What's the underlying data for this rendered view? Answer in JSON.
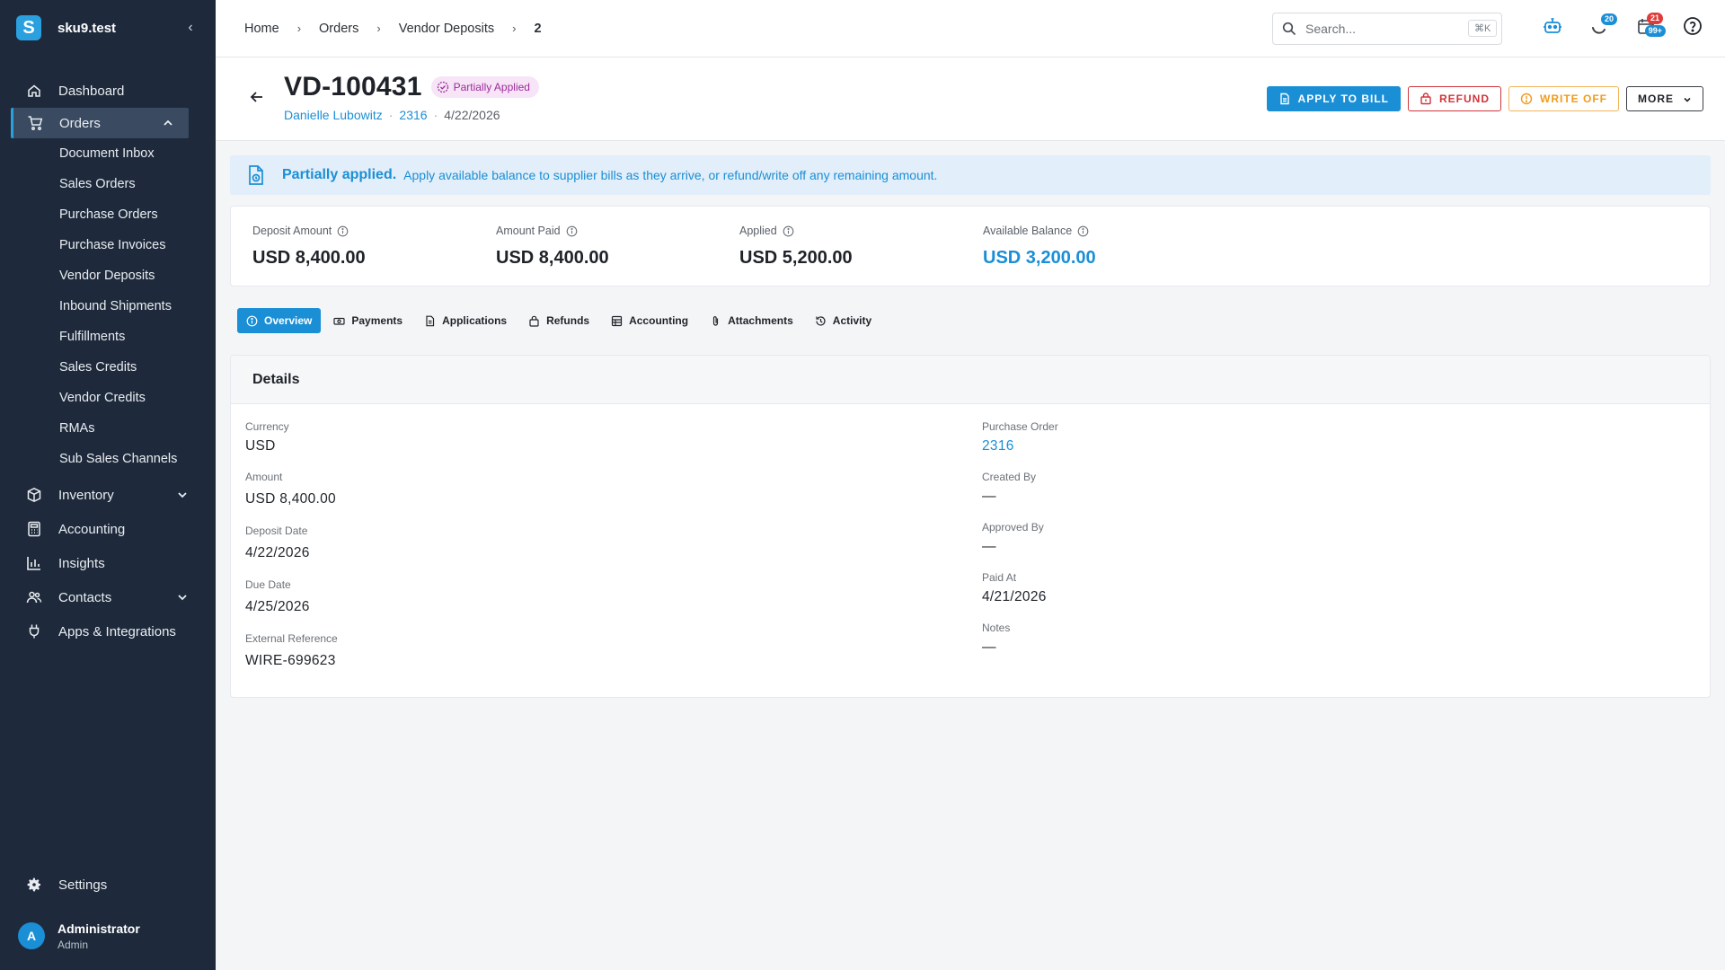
{
  "brand": {
    "name": "sku9.test",
    "logo_letter": "S",
    "collapse_icon": "chevron-left-icon"
  },
  "nav": {
    "dashboard": "Dashboard",
    "orders": "Orders",
    "orders_sub": [
      "Document Inbox",
      "Sales Orders",
      "Purchase Orders",
      "Purchase Invoices",
      "Vendor Deposits",
      "Inbound Shipments",
      "Fulfillments",
      "Sales Credits",
      "Vendor Credits",
      "RMAs",
      "Sub Sales Channels"
    ],
    "inventory": "Inventory",
    "accounting": "Accounting",
    "insights": "Insights",
    "contacts": "Contacts",
    "apps": "Apps & Integrations",
    "settings": "Settings"
  },
  "user": {
    "initial": "A",
    "name": "Administrator",
    "role": "Admin"
  },
  "breadcrumb": {
    "home": "Home",
    "orders": "Orders",
    "vendor_deposits": "Vendor Deposits",
    "current": "2"
  },
  "search": {
    "placeholder": "Search...",
    "shortcut": "⌘K"
  },
  "badges": {
    "tasks": "20",
    "alerts_top": "21",
    "alerts_bottom": "99+"
  },
  "header": {
    "title": "VD-100431",
    "status": "Partially Applied",
    "vendor": "Danielle Lubowitz",
    "po": "2316",
    "date": "4/22/2026"
  },
  "actions": {
    "apply": "APPLY TO BILL",
    "refund": "REFUND",
    "write_off": "WRITE OFF",
    "more": "MORE"
  },
  "banner": {
    "title": "Partially applied.",
    "text": "Apply available balance to supplier bills as they arrive, or refund/write off any remaining amount."
  },
  "metrics": [
    {
      "label": "Deposit Amount",
      "value": "USD 8,400.00"
    },
    {
      "label": "Amount Paid",
      "value": "USD 8,400.00"
    },
    {
      "label": "Applied",
      "value": "USD 5,200.00"
    },
    {
      "label": "Available Balance",
      "value": "USD 3,200.00"
    }
  ],
  "tabs": [
    "Overview",
    "Payments",
    "Applications",
    "Refunds",
    "Accounting",
    "Attachments",
    "Activity"
  ],
  "details": {
    "title": "Details",
    "left": [
      {
        "label": "Currency",
        "value": "USD"
      },
      {
        "label": "Amount",
        "value": "USD 8,400.00"
      },
      {
        "label": "Deposit Date",
        "value": "4/22/2026"
      },
      {
        "label": "Due Date",
        "value": "4/25/2026"
      },
      {
        "label": "External Reference",
        "value": "WIRE-699623"
      }
    ],
    "right": [
      {
        "label": "Purchase Order",
        "value": "2316"
      },
      {
        "label": "Created By",
        "value": "—"
      },
      {
        "label": "Approved By",
        "value": "—"
      },
      {
        "label": "Paid At",
        "value": "4/21/2026"
      },
      {
        "label": "Notes",
        "value": "—"
      }
    ]
  },
  "colors": {
    "accent": "#1b8fd6",
    "sidebar": "#1e2a3b",
    "status_bg": "#f7e4f7",
    "status_fg": "#9b2d9b",
    "danger": "#d0343a",
    "warning": "#f29b1b"
  }
}
